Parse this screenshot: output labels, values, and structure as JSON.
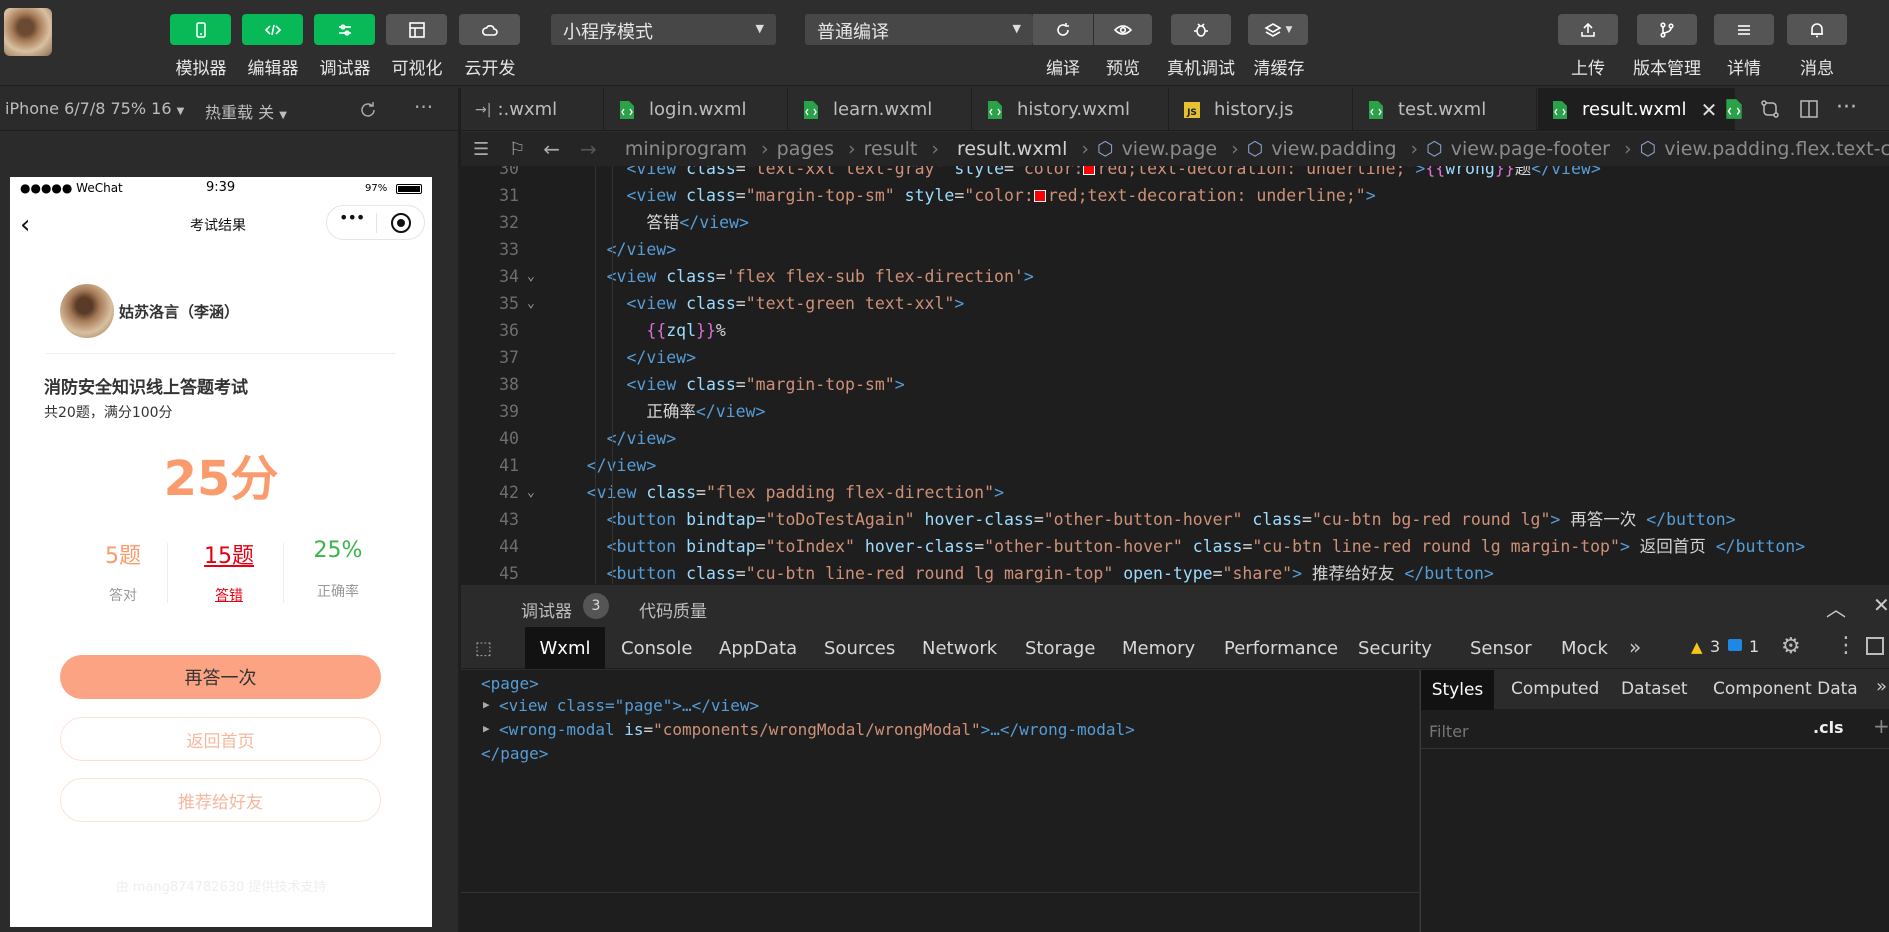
{
  "toolbar": {
    "left_buttons": [
      {
        "label": "模拟器",
        "icon": "phone-icon",
        "color": "green"
      },
      {
        "label": "编辑器",
        "icon": "code-icon",
        "color": "green"
      },
      {
        "label": "调试器",
        "icon": "sliders-icon",
        "color": "green"
      },
      {
        "label": "可视化",
        "icon": "layout-icon",
        "color": "gray"
      },
      {
        "label": "云开发",
        "icon": "cloud-icon",
        "color": "gray"
      }
    ],
    "mode_select": "小程序模式",
    "compile_select": "普通编译",
    "compile_actions": [
      {
        "label": "编译",
        "icon": "refresh-icon"
      },
      {
        "label": "预览",
        "icon": "eye-icon"
      },
      {
        "label": "真机调试",
        "icon": "bug-icon"
      },
      {
        "label": "清缓存",
        "icon": "layers-icon"
      }
    ],
    "right_actions": [
      {
        "label": "上传",
        "icon": "upload-icon"
      },
      {
        "label": "版本管理",
        "icon": "branch-icon"
      },
      {
        "label": "详情",
        "icon": "menu-icon"
      },
      {
        "label": "消息",
        "icon": "bell-icon"
      }
    ]
  },
  "simulator": {
    "device": "iPhone 6/7/8 75% 16",
    "hot_reload": "热重载 关",
    "more": "···"
  },
  "phone": {
    "status_carrier": "●●●●● WeChat",
    "status_time": "9:39",
    "status_battery": "97%",
    "nav_title": "考试结果",
    "user_name": "姑苏洛言（李涵）",
    "exam_title": "消防安全知识线上答题考试",
    "exam_sub": "共20题，满分100分",
    "score": "25分",
    "stats": [
      {
        "value": "5题",
        "label": "答对"
      },
      {
        "value": "15题",
        "label": "答错"
      },
      {
        "value": "25%",
        "label": "正确率"
      }
    ],
    "btn_again": "再答一次",
    "btn_home": "返回首页",
    "btn_share": "推荐给好友",
    "footer": "由 mang874782630 提供技术支持"
  },
  "tabs": [
    {
      "name": ":.wxml",
      "type": "wxml"
    },
    {
      "name": "login.wxml",
      "type": "wxml"
    },
    {
      "name": "learn.wxml",
      "type": "wxml"
    },
    {
      "name": "history.wxml",
      "type": "wxml"
    },
    {
      "name": "history.js",
      "type": "js"
    },
    {
      "name": "test.wxml",
      "type": "wxml"
    },
    {
      "name": "result.wxml",
      "type": "wxml",
      "active": true
    }
  ],
  "breadcrumb": [
    "miniprogram",
    "pages",
    "result",
    "result.wxml",
    "view.page",
    "view.padding",
    "view.page-footer",
    "view.padding.flex.text-center."
  ],
  "code_lines": [
    "30",
    "31",
    "32",
    "33",
    "34",
    "35",
    "36",
    "37",
    "38",
    "39",
    "40",
    "41",
    "42",
    "43",
    "44",
    "45"
  ],
  "code": {
    "l30_class": "\"text-xxl text-gray\"",
    "l30_style_a": "\"color:",
    "l30_style_b": "red;text-decoration: underline;\"",
    "l30_expr": "wrong",
    "l30_text": "题",
    "l31_class": "\"margin-top-sm\"",
    "l31_style_a": "\"color:",
    "l31_style_b": "red;text-decoration: underline;\"",
    "l32_text": "答错",
    "l34_class": "'flex flex-sub flex-direction'",
    "l35_class": "\"text-green text-xxl\"",
    "l36_expr": "zql",
    "l36_text": "%",
    "l38_class": "\"margin-top-sm\"",
    "l39_text": "正确率",
    "l42_class": "\"flex padding flex-direction\"",
    "l43_bind": "\"toDoTestAgain\"",
    "l43_hover": "\"other-button-hover\"",
    "l43_class": "\"cu-btn bg-red round lg\"",
    "l43_text": " 再答一次 ",
    "l44_bind": "\"toIndex\"",
    "l44_hover": "\"other-button-hover\"",
    "l44_class": "\"cu-btn line-red round lg margin-top\"",
    "l44_text": " 返回首页 ",
    "l45_class": "\"cu-btn line-red round lg margin-top\"",
    "l45_open": "\"share\"",
    "l45_text": " 推荐给好友 "
  },
  "debugger": {
    "title": "调试器",
    "badge": "3",
    "quality": "代码质量",
    "tabs": [
      "Wxml",
      "Console",
      "AppData",
      "Sources",
      "Network",
      "Storage",
      "Memory",
      "Performance",
      "Security",
      "Sensor",
      "Mock"
    ],
    "warn_count": "3",
    "info_count": "1",
    "wxml_tree": {
      "root_open": "<page>",
      "view_node": "<view class=\"page\">…</view>",
      "modal_node_tag": "<wrong-modal",
      "modal_node_attr": "is",
      "modal_node_val": "\"components/wrongModal/wrongModal\"",
      "modal_node_tail": ">…</wrong-modal>",
      "root_close": "</page>"
    },
    "styles_tabs": [
      "Styles",
      "Computed",
      "Dataset",
      "Component Data"
    ],
    "filter_placeholder": "Filter",
    "cls": ".cls"
  },
  "colors": {
    "green": "#07b957",
    "accent_orange": "#fa9b6e",
    "red": "#e60012",
    "green_text": "#39b54a"
  }
}
